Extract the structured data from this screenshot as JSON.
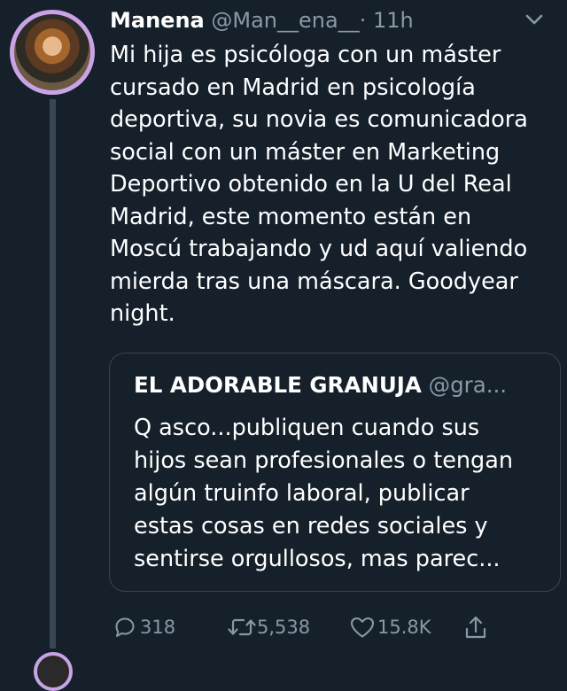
{
  "tweet": {
    "author_name": "Manena",
    "author_handle": "@Man__ena__",
    "separator": "·",
    "time": "11h",
    "text": "Mi hija es psicóloga con un máster\ncursado en Madrid en psicología\ndeportiva, su novia es comunicadora\nsocial con un máster en Marketing\nDeportivo obtenido en la U del Real\nMadrid, este momento están en\nMoscú trabajando y ud aquí valiendo\nmierda tras una máscara. Goodyear\nnight."
  },
  "quoted_tweet": {
    "author_name": "EL ADORABLE GRANUJA",
    "author_handle": "@gra...",
    "text": "Q asco...publiquen cuando sus\nhijos sean profesionales o tengan\nalgún truinfo laboral, publicar\nestas cosas en redes sociales y\nsentirse orgullosos, mas parec..."
  },
  "actions": {
    "replies": "318",
    "retweets": "5,538",
    "likes": "15.8K"
  },
  "colors": {
    "background": "#15202b",
    "secondary_text": "#8899a6",
    "avatar_ring": "#c9a3e6",
    "border": "#38444d"
  },
  "icons": {
    "more": "chevron-down-icon",
    "reply": "reply-icon",
    "retweet": "retweet-icon",
    "like": "heart-icon",
    "share": "share-icon"
  }
}
